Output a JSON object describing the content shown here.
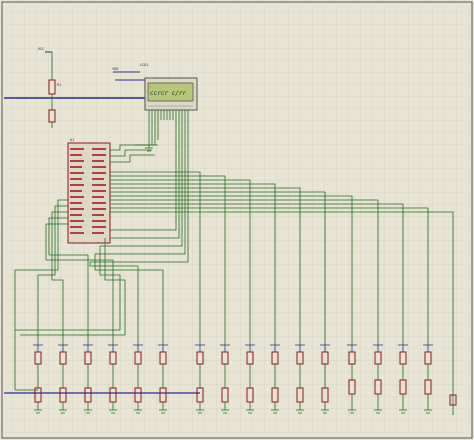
{
  "schematic": {
    "lcd_display_text": "ccrcr c/rr",
    "colors": {
      "background": "#e8e4d4",
      "grid": "#cdc9b8",
      "wire": "#1f6b1f",
      "bus": "#2b2b9a",
      "component": "#8a1a1a",
      "lcd_screen": "#b6c77a"
    }
  }
}
